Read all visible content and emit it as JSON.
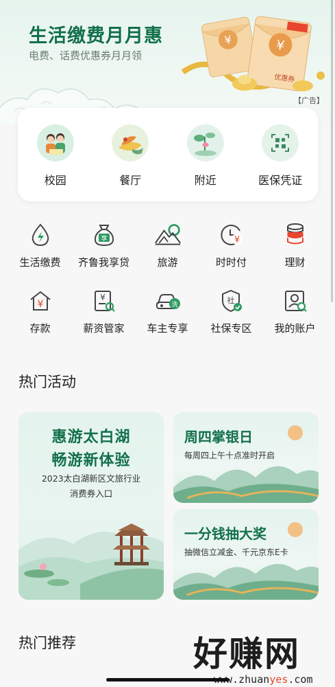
{
  "banner": {
    "title": "生活缴费月月惠",
    "subtitle": "电费、话费优惠券月月领",
    "ad_tag": "【广告】",
    "coupon_label": "优惠券"
  },
  "quick_entries": [
    {
      "label": "校园",
      "icon": "students-icon"
    },
    {
      "label": "餐厅",
      "icon": "restaurant-icon"
    },
    {
      "label": "附近",
      "icon": "nearby-icon"
    },
    {
      "label": "医保凭证",
      "icon": "qrcode-icon"
    }
  ],
  "services": [
    {
      "label": "生活缴费",
      "icon": "water-drop-bolt-icon",
      "glyph": ""
    },
    {
      "label": "齐鲁我享贷",
      "icon": "money-bag-icon",
      "glyph": "享"
    },
    {
      "label": "旅游",
      "icon": "mountain-icon",
      "glyph": ""
    },
    {
      "label": "时时付",
      "icon": "clock-yuan-icon",
      "glyph": "¥"
    },
    {
      "label": "理财",
      "icon": "coin-stack-icon",
      "glyph": ""
    },
    {
      "label": "存款",
      "icon": "house-yuan-icon",
      "glyph": "¥"
    },
    {
      "label": "薪资管家",
      "icon": "salary-document-icon",
      "glyph": "¥"
    },
    {
      "label": "车主专享",
      "icon": "car-wash-icon",
      "glyph": "洗"
    },
    {
      "label": "社保专区",
      "icon": "shield-social-icon",
      "glyph": "社"
    },
    {
      "label": "我的账户",
      "icon": "account-search-icon",
      "glyph": ""
    }
  ],
  "sections": {
    "hot_activities": "热门活动",
    "hot_recommend": "热门推荐"
  },
  "activities": {
    "big": {
      "title1": "惠游太白湖",
      "title2": "畅游新体验",
      "sub1": "2023太白湖新区文旅行业",
      "sub2": "消费券入口"
    },
    "small1": {
      "title": "周四掌银日",
      "sub": "每周四上午十点准时开启"
    },
    "small2": {
      "title": "一分钱抽大奖",
      "sub": "抽微信立减金、千元京东E卡"
    }
  },
  "watermark": {
    "text": "好赚网",
    "url_pre": "www.zhuan",
    "url_hl": "yes",
    "url_post": ".com"
  },
  "colors": {
    "brand_green": "#12704a",
    "accent_red": "#e8462e",
    "icon_green": "#2e8b57"
  }
}
